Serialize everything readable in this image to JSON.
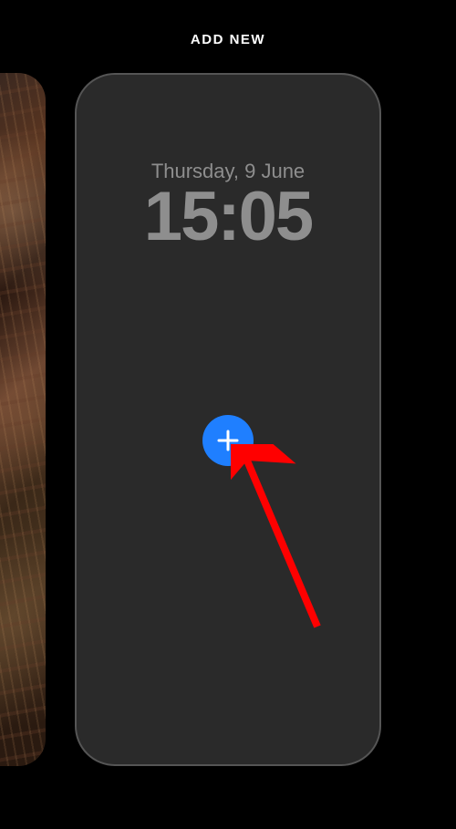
{
  "header": {
    "title": "ADD NEW"
  },
  "lockscreen": {
    "date": "Thursday, 9 June",
    "time": "15:05"
  },
  "colors": {
    "accent": "#1f7fff",
    "annotation": "#ff0000"
  }
}
